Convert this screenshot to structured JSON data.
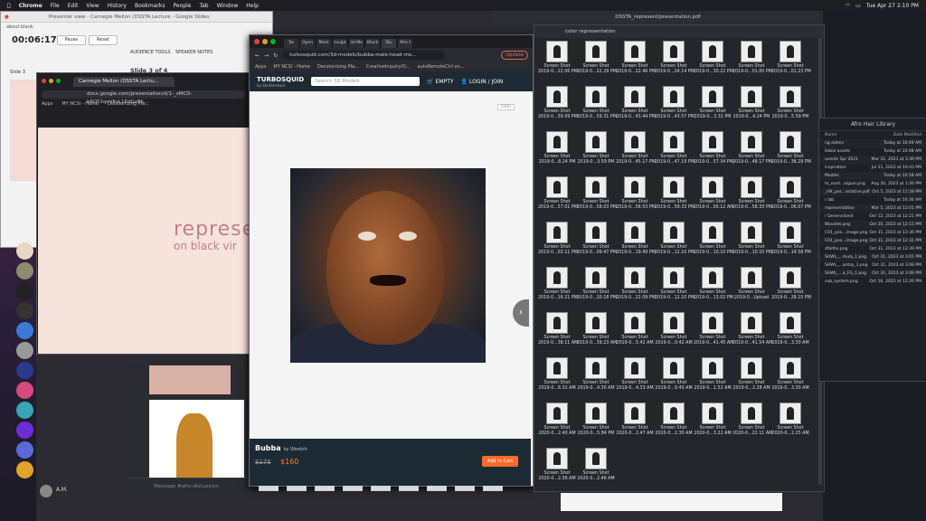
{
  "menubar": {
    "app": "Chrome",
    "items": [
      "File",
      "Edit",
      "View",
      "History",
      "Bookmarks",
      "People",
      "Tab",
      "Window",
      "Help"
    ],
    "clock": "Tue Apr 27 2:10 PM"
  },
  "slides_window": {
    "title": "Presenter view - Carnegie Mellon (DSSTA Lecture - Google Slides",
    "tab": "about:blank",
    "timer": "00:06:17",
    "pause": "Pause",
    "reset": "Reset",
    "audience_tools": "AUDIENCE TOOLS",
    "speaker_notes": "SPEAKER NOTES",
    "slide_label": "Slide 3",
    "slide_of": "Slide 3 of 4"
  },
  "doc_window": {
    "tab": "Carnegie Mellon (DSSTA Lectu...",
    "url": "docs.google.com/presentation/d/1-_sMCD-b6OY2qoVKyL16dGxBk...",
    "bookmarks": [
      "Apps",
      "MY NCSI - Home",
      "Decolonizing Pla..."
    ],
    "slide_text_1": "represe",
    "slide_text_2": "on black vir"
  },
  "turbosquid": {
    "tabs": [
      "Tw",
      "Open",
      "Mast",
      "sculpt",
      "3d Mo",
      "Black",
      "Bu",
      "Afro t"
    ],
    "url": "turbosquid.com/3d-models/bubba-male-head-mo...",
    "update": "Update",
    "bookmarks": [
      "Apps",
      "MY NCSI - Home",
      "Decolonizing Pla...",
      "CreativeInquiry/O...",
      "autoRemoteCtrl on..."
    ],
    "logo": "TURBOSQUID",
    "logo_sub": "by Shutterstock",
    "search_placeholder": "Search 3D Models",
    "empty": "EMPTY",
    "login": "LOGIN / JOIN",
    "zoom_btn": "1080",
    "product_name": "Bubba",
    "product_by": "by Weekrk",
    "old_price": "$175",
    "price": "$160",
    "cart": "Add to Cart",
    "next": "❯"
  },
  "finder": {
    "title": "color representation",
    "pdf_title": "DSSTA_represent/presentation.pdf",
    "items": [
      {
        "l1": "Screen Shot",
        "l2": "2019-0...22.06 PM"
      },
      {
        "l1": "Screen Shot",
        "l2": "2019-0...22.29 PM"
      },
      {
        "l1": "Screen Shot",
        "l2": "2019-0...22.46 PM"
      },
      {
        "l1": "Screen Shot",
        "l2": "2019-0...24.14 PM"
      },
      {
        "l1": "Screen Shot",
        "l2": "2019-0...30.22 PM"
      },
      {
        "l1": "Screen Shot",
        "l2": "2019-0...01.00 PM"
      },
      {
        "l1": "Screen Shot",
        "l2": "2019-0...01.23 PM"
      },
      {
        "l1": "Screen Shot",
        "l2": "2019-0...59.09 PM"
      },
      {
        "l1": "Screen Shot",
        "l2": "2019-0...59.31 PM"
      },
      {
        "l1": "Screen Shot",
        "l2": "2019-0...43.44 PM"
      },
      {
        "l1": "Screen Shot",
        "l2": "2019-0...43.57 PM"
      },
      {
        "l1": "Screen Shot",
        "l2": "2019-0...3.31 PM"
      },
      {
        "l1": "Screen Shot",
        "l2": "2019-0...4.24 PM"
      },
      {
        "l1": "Screen Shot",
        "l2": "2019-0...5.59 PM"
      },
      {
        "l1": "Screen Shot",
        "l2": "2019-0...8.24 PM"
      },
      {
        "l1": "Screen Shot",
        "l2": "2019-0...3.59 PM"
      },
      {
        "l1": "Screen Shot",
        "l2": "2019-0...45.17 PM"
      },
      {
        "l1": "Screen Shot",
        "l2": "2019-0...47.19 PM"
      },
      {
        "l1": "Screen Shot",
        "l2": "2019-0...57.34 PM"
      },
      {
        "l1": "Screen Shot",
        "l2": "2019-0...48.17 PM"
      },
      {
        "l1": "Screen Shot",
        "l2": "2019-0...38.29 PM"
      },
      {
        "l1": "Screen Shot",
        "l2": "2019-0...57.01 PM"
      },
      {
        "l1": "Screen Shot",
        "l2": "2019-0...58.03 PM"
      },
      {
        "l1": "Screen Shot",
        "l2": "2019-0...58.53 PM"
      },
      {
        "l1": "Screen Shot",
        "l2": "2019-0...59.33 PM"
      },
      {
        "l1": "Screen Shot",
        "l2": "2019-0...00.12 AM"
      },
      {
        "l1": "Screen Shot",
        "l2": "2019-0...58.33 PM"
      },
      {
        "l1": "Screen Shot",
        "l2": "2019-0...06.07 PM"
      },
      {
        "l1": "Screen Shot",
        "l2": "2019-0...03.11 PM"
      },
      {
        "l1": "Screen Shot",
        "l2": "2019-0...09.47 PM"
      },
      {
        "l1": "Screen Shot",
        "l2": "2019-0...19.49 PM"
      },
      {
        "l1": "Screen Shot",
        "l2": "2019-0...12.10 PM"
      },
      {
        "l1": "Screen Shot",
        "l2": "2019-0...10.10 PM"
      },
      {
        "l1": "Screen Shot",
        "l2": "2019-0...10.10 PM"
      },
      {
        "l1": "Screen Shot",
        "l2": "2019-0...14.58 PM"
      },
      {
        "l1": "Screen Shot",
        "l2": "2019-0...16.21 PM"
      },
      {
        "l1": "Screen Shot",
        "l2": "2019-0...20.18 PM"
      },
      {
        "l1": "Screen Shot",
        "l2": "2019-0...22.09 PM"
      },
      {
        "l1": "Screen Shot",
        "l2": "2019-0...12.10 PM"
      },
      {
        "l1": "Screen Shot",
        "l2": "2019-0...13.02 PM"
      },
      {
        "l1": "Screen Shot",
        "l2": "2019-0...Upload"
      },
      {
        "l1": "Screen Shot",
        "l2": "2019-0...28.15 PM"
      },
      {
        "l1": "Screen Shot",
        "l2": "2019-0...38.11 AM"
      },
      {
        "l1": "Screen Shot",
        "l2": "2019-0...39.23 AM"
      },
      {
        "l1": "Screen Shot",
        "l2": "2019-0...5.42 AM"
      },
      {
        "l1": "Screen Shot",
        "l2": "2019-0...0.42 AM"
      },
      {
        "l1": "Screen Shot",
        "l2": "2019-0...41.45 AM"
      },
      {
        "l1": "Screen Shot",
        "l2": "2019-0...41.54 AM"
      },
      {
        "l1": "Screen Shot",
        "l2": "2019-0...3.30 AM"
      },
      {
        "l1": "Screen Shot",
        "l2": "2019-0...6.32 AM"
      },
      {
        "l1": "Screen Shot",
        "l2": "2019-0...4.30 AM"
      },
      {
        "l1": "Screen Shot",
        "l2": "2019-0...4.33 AM"
      },
      {
        "l1": "Screen Shot",
        "l2": "2019-0...0.40 AM"
      },
      {
        "l1": "Screen Shot",
        "l2": "2019-0...1.52 AM"
      },
      {
        "l1": "Screen Shot",
        "l2": "2019-0...2.28 AM"
      },
      {
        "l1": "Screen Shot",
        "l2": "2019-0...3.30 AM"
      },
      {
        "l1": "Screen Shot",
        "l2": "2020-0...2.40 AM"
      },
      {
        "l1": "Screen Shot",
        "l2": "2020-0...5.84 PM"
      },
      {
        "l1": "Screen Shot",
        "l2": "2020-0...2.47 AM"
      },
      {
        "l1": "Screen Shot",
        "l2": "2020-0...2.30 AM"
      },
      {
        "l1": "Screen Shot",
        "l2": "2020-0...3.22 AM"
      },
      {
        "l1": "Screen Shot",
        "l2": "2020-0...22.11 AM"
      },
      {
        "l1": "Screen Shot",
        "l2": "2020-0...2.25 AM"
      },
      {
        "l1": "Screen Shot",
        "l2": "2020-0...2.36 AM"
      },
      {
        "l1": "Screen Shot",
        "l2": "2020-0...2.46 AM"
      }
    ]
  },
  "file_panel": {
    "title": "Afro Hair Library",
    "col_name": "Name",
    "col_date": "Date Modified",
    "rows": [
      {
        "n": "ng admin",
        "d": "Today at 10:09 AM"
      },
      {
        "n": "llobal assets",
        "d": "Today at 10:08 AM"
      },
      {
        "n": "ovents Spr 2021",
        "d": "Mar 31, 2021 at 3:39 PM"
      },
      {
        "n": "inspiration",
        "d": "Jul 21, 2023 at 10:43 PM"
      },
      {
        "n": "Models",
        "d": "Today at 10:58 AM"
      },
      {
        "n": "to_mod...algual.png",
        "d": "Aug 30, 2023 at 1:26 PM"
      },
      {
        "n": "_HK_pos...sstative.pdf",
        "d": "Oct 5, 2023 at 11:28 PM"
      },
      {
        "n": "r lab",
        "d": "Today at 10:36 AM"
      },
      {
        "n": "representation",
        "d": "Mar 5, 2023 at 12:01 PM"
      },
      {
        "n": "r Devenviland",
        "d": "Oct 12, 2023 at 12:21 PM"
      },
      {
        "n": "Wavelet.png",
        "d": "Oct 20, 2023 at 12:15 PM"
      },
      {
        "n": "C01_pos...image.png",
        "d": "Oct 31, 2023 at 12:36 PM"
      },
      {
        "n": "C01_pos...image.png",
        "d": "Oct 31, 2023 at 12:31 PM"
      },
      {
        "n": "dfaiths.png",
        "d": "Oct 31, 2023 at 12:39 PM"
      },
      {
        "n": "SHWL_...mula_1.png",
        "d": "Oct 31, 2023 at 3:01 PM"
      },
      {
        "n": "SHWL_...antsp_1.png",
        "d": "Oct 31, 2023 at 3:08 PM"
      },
      {
        "n": "SHWL_...a_FG_1.png",
        "d": "Oct 31, 2023 at 3:08 PM"
      },
      {
        "n": "sub_system.png",
        "d": "Oct 16, 2023 at 12:26 PM"
      }
    ]
  },
  "chat": {
    "placeholder": "Message #afro-discussion",
    "user": "A.M."
  },
  "colors": {
    "accent": "#ff6a2a",
    "turbosquid_nav": "#1e2a33",
    "slide_bg": "#f6e3dc",
    "slide_text": "#c07f86"
  }
}
